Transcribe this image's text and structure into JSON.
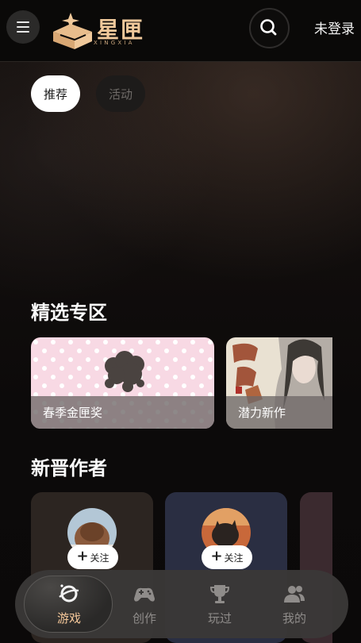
{
  "header": {
    "brand": "星匣",
    "brand_sub": "XINGXIA",
    "login": "未登录"
  },
  "tabs": [
    {
      "label": "推荐",
      "active": true
    },
    {
      "label": "活动",
      "active": false
    }
  ],
  "featured": {
    "title": "精选专区",
    "cards": [
      {
        "label": "春季金匣奖"
      },
      {
        "label": "潜力新作"
      }
    ]
  },
  "authors": {
    "title": "新晋作者",
    "cards": [
      {
        "follow": "关注"
      },
      {
        "follow": "关注"
      }
    ]
  },
  "nav": {
    "items": [
      {
        "label": "游戏",
        "icon": "game-planet-icon",
        "active": true
      },
      {
        "label": "创作",
        "icon": "gamepad-icon",
        "active": false
      },
      {
        "label": "玩过",
        "icon": "trophy-icon",
        "active": false
      },
      {
        "label": "我的",
        "icon": "users-icon",
        "active": false
      }
    ]
  },
  "colors": {
    "accent": "#f5c89a",
    "background": "#0b0909"
  }
}
